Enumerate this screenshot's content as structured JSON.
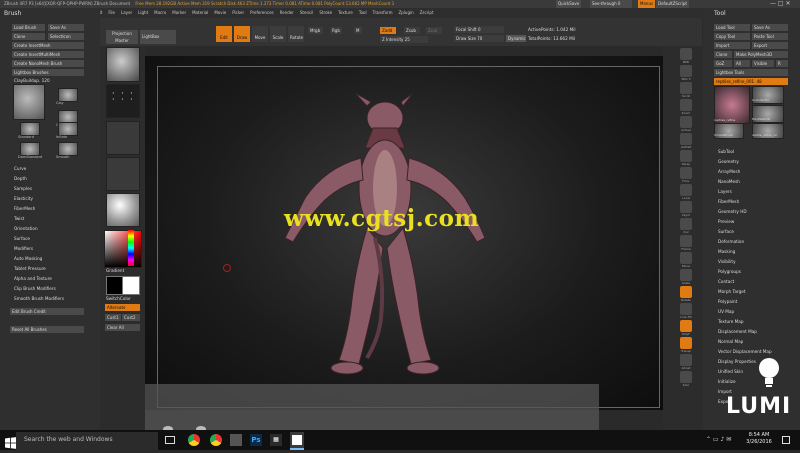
{
  "window": {
    "title": "ZBrush 4R7 P3 [x64][XQR-QFP-QPHP-PWRN] ZBrush Document",
    "stats": "Free Mem 28.192GB  Active Mem 319  Scratch Disk 463  ZTime 1.373  Timer 0.081  ATime 0.081  PolyCount 13.662 MP  MeshCount 1",
    "quicksave": "QuickSave",
    "see_through": "See-through 0",
    "menus_label": "Menus",
    "default_script": "DefaultZScript"
  },
  "menubar": [
    "Alpha",
    "Brush",
    "Color",
    "Document",
    "Draw",
    "Edit",
    "File",
    "Layer",
    "Light",
    "Macro",
    "Marker",
    "Material",
    "Movie",
    "Picker",
    "Preferences",
    "Render",
    "Stencil",
    "Stroke",
    "Texture",
    "Tool",
    "Transform",
    "Zplugin",
    "Zscript"
  ],
  "toolbar": {
    "projection_master": "Projection Master",
    "lightbox": "LightBox",
    "edit": "Edit",
    "draw": "Draw",
    "move": "Move",
    "scale": "Scale",
    "rotate": "Rotate",
    "mrgb": "Mrgb",
    "rgb": "Rgb",
    "m": "M",
    "zadd": "Zadd",
    "zsub": "Zsub",
    "zcut": "Zcut",
    "focal_shift": "Focal Shift 0",
    "draw_size": "Draw Size 70",
    "z_intensity": "Z Intensity 25",
    "dynamic": "Dynamic",
    "active_points": "ActivePoints: 1.042 Mil",
    "total_points": "TotalPoints: 13.662 Mil"
  },
  "brush_palette": {
    "title": "Brush",
    "load_brush": "Load Brush",
    "save_as": "Save As",
    "clone": "Clone",
    "select_icon": "SelectIcon",
    "create_insert_mesh": "Create InsertMesh",
    "create_insert_multimesh": "Create InsertMultiMesh",
    "create_nanomesh": "Create NanoMesh Brush",
    "lightbox_brushes": "Lightbox Brushes",
    "current_brush": "ClayBuildup. 120",
    "brushes": [
      "Clay",
      "ClayBuildup",
      "Standard",
      "Inflate",
      "DamStandard",
      "Smooth"
    ],
    "sections": [
      "Curve",
      "Depth",
      "Samples",
      "Elasticity",
      "FiberMesh",
      "Twist",
      "Orientation",
      "Surface",
      "Modifiers",
      "Auto Masking",
      "Tablet Pressure",
      "Alpha and Texture",
      "Clip Brush Modifiers",
      "Smooth Brush Modifiers"
    ],
    "edit_brush_credit": "Edit Brush Credit",
    "reset_all_brushes": "Reset All Brushes"
  },
  "left_shelf": {
    "gradient": "Gradient",
    "switch_color": "SwitchColor",
    "alternate": "Alternate",
    "cust1": "Cust1",
    "cust2": "Cust2",
    "clear_all": "Clear All"
  },
  "right_shelf": [
    "BPR",
    "SPix 3",
    "Scroll",
    "Zoom",
    "Actual",
    "AAHalf",
    "Persp",
    "Floor",
    "Local",
    "LSym",
    "Xyz",
    "Frame",
    "Move",
    "Scale",
    "Rotate",
    "Line Fill",
    "PolyF",
    "Transp",
    "Ghost",
    "Solo"
  ],
  "tool_palette": {
    "title": "Tool",
    "load_tool": "Load Tool",
    "save_as": "Save As",
    "copy_tool": "Copy Tool",
    "paste_tool": "Paste Tool",
    "import": "Import",
    "export": "Export",
    "clone": "Clone",
    "make_polymesh3d": "Make PolyMesh3D",
    "goz": "GoZ",
    "all": "All",
    "visible": "Visible",
    "r": "R",
    "lightbox_tools": "Lightbox Tools",
    "current_tool": "reptiles_refine_001. 48",
    "tools": [
      "reptiles_refine",
      "Cylinder3D",
      "SimpleBrush",
      "PolyMesh3D",
      "reptile_refine_v2"
    ],
    "sections": [
      "SubTool",
      "Geometry",
      "ArrayMesh",
      "NanoMesh",
      "Layers",
      "FiberMesh",
      "Geometry HD",
      "Preview",
      "Surface",
      "Deformation",
      "Masking",
      "Visibility",
      "Polygroups",
      "Contact",
      "Morph Target",
      "Polypaint",
      "UV Map",
      "Texture Map",
      "Displacement Map",
      "Normal Map",
      "Vector Displacement Map",
      "Display Properties",
      "Unified Skin",
      "Initialize",
      "Import",
      "Export"
    ]
  },
  "watermark": "www.cgtsj.com",
  "lumi_logo": "LUMI",
  "taskbar": {
    "search_placeholder": "Search the web and Windows",
    "time": "8:54 AM",
    "date": "3/26/2016"
  }
}
